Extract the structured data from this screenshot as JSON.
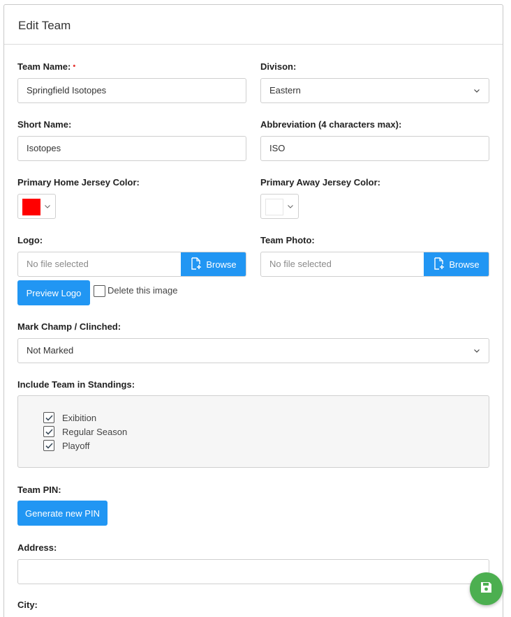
{
  "header": {
    "title": "Edit Team"
  },
  "team_name": {
    "label": "Team Name:",
    "required_marker": "•",
    "value": "Springfield Isotopes"
  },
  "division": {
    "label": "Divison:",
    "value": "Eastern"
  },
  "short_name": {
    "label": "Short Name:",
    "value": "Isotopes"
  },
  "abbreviation": {
    "label": "Abbreviation (4 characters max):",
    "value": "ISO"
  },
  "home_jersey": {
    "label": "Primary Home Jersey Color:",
    "color": "#ff0000"
  },
  "away_jersey": {
    "label": "Primary Away Jersey Color:",
    "color": "#ffffff"
  },
  "logo": {
    "label": "Logo:",
    "placeholder": "No file selected",
    "browse_label": "Browse",
    "preview_label": "Preview Logo",
    "delete_label": "Delete this image",
    "delete_checked": false
  },
  "team_photo": {
    "label": "Team Photo:",
    "placeholder": "No file selected",
    "browse_label": "Browse"
  },
  "mark_champ": {
    "label": "Mark Champ / Clinched:",
    "value": "Not Marked"
  },
  "standings": {
    "label": "Include Team in Standings:",
    "options": [
      {
        "label": "Exibition",
        "checked": true
      },
      {
        "label": "Regular Season",
        "checked": true
      },
      {
        "label": "Playoff",
        "checked": true
      }
    ]
  },
  "team_pin": {
    "label": "Team PIN:",
    "button_label": "Generate new PIN"
  },
  "address": {
    "label": "Address:",
    "value": ""
  },
  "city": {
    "label": "City:"
  },
  "colors": {
    "accent": "#2196f3",
    "save_fab": "#4caf50"
  },
  "icons": {
    "save": "floppy-disk-icon",
    "browse": "file-add-icon",
    "select": "chevron-down-icon"
  }
}
